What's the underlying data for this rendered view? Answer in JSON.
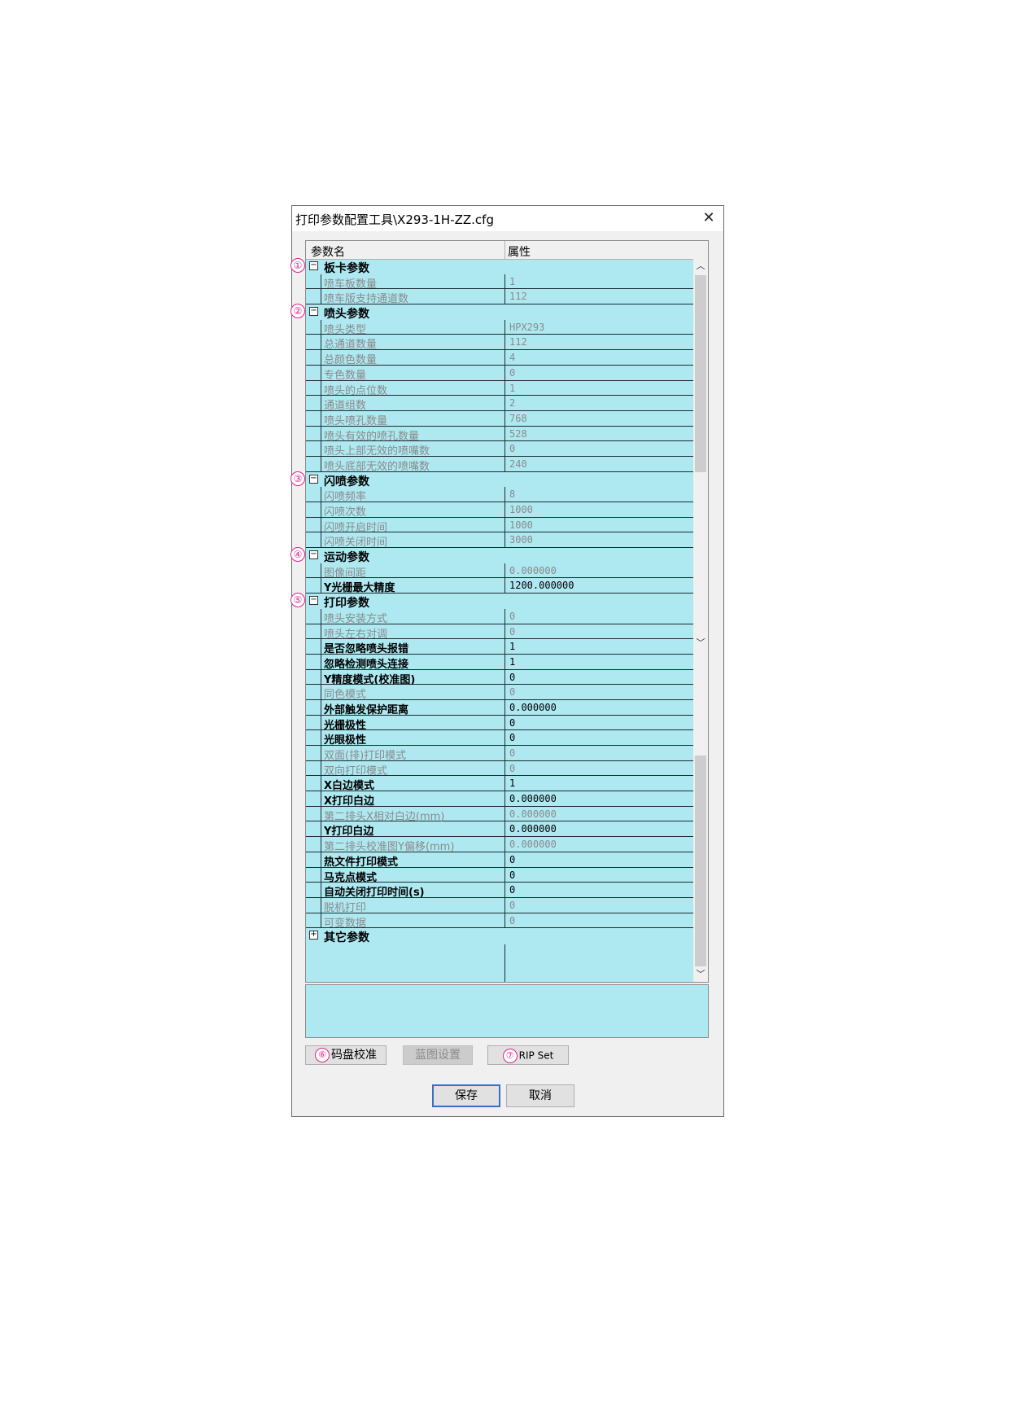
{
  "window": {
    "title": "打印参数配置工具\\X293-1H-ZZ.cfg",
    "close_glyph": "✕"
  },
  "grid": {
    "header_name": "参数名",
    "header_attr": "属性"
  },
  "markers": [
    "①",
    "②",
    "③",
    "④",
    "⑤"
  ],
  "rows": [
    {
      "type": "group",
      "marker": "①",
      "expand": "−",
      "name": "板卡参数"
    },
    {
      "type": "item",
      "enabled": false,
      "name": "喷车板数量",
      "value": "1"
    },
    {
      "type": "item",
      "enabled": false,
      "name": "喷车版支持通道数",
      "value": "112"
    },
    {
      "type": "group",
      "marker": "②",
      "expand": "−",
      "name": "喷头参数"
    },
    {
      "type": "item",
      "enabled": false,
      "name": "喷头类型",
      "value": "HPX293"
    },
    {
      "type": "item",
      "enabled": false,
      "name": "总通道数量",
      "value": "112"
    },
    {
      "type": "item",
      "enabled": false,
      "name": "总颜色数量",
      "value": "4"
    },
    {
      "type": "item",
      "enabled": false,
      "name": "专色数量",
      "value": "0"
    },
    {
      "type": "item",
      "enabled": false,
      "name": "喷头的点位数",
      "value": "1"
    },
    {
      "type": "item",
      "enabled": false,
      "name": "通道组数",
      "value": "2"
    },
    {
      "type": "item",
      "enabled": false,
      "name": "喷头喷孔数量",
      "value": "768"
    },
    {
      "type": "item",
      "enabled": false,
      "name": "喷头有效的喷孔数量",
      "value": "528"
    },
    {
      "type": "item",
      "enabled": false,
      "name": "喷头上部无效的喷嘴数",
      "value": "0"
    },
    {
      "type": "item",
      "enabled": false,
      "name": "喷头底部无效的喷嘴数",
      "value": "240"
    },
    {
      "type": "group",
      "marker": "③",
      "expand": "−",
      "name": "闪喷参数"
    },
    {
      "type": "item",
      "enabled": false,
      "name": "闪喷频率",
      "value": "8"
    },
    {
      "type": "item",
      "enabled": false,
      "name": "闪喷次数",
      "value": "1000"
    },
    {
      "type": "item",
      "enabled": false,
      "name": "闪喷开启时间",
      "value": "1000"
    },
    {
      "type": "item",
      "enabled": false,
      "name": "闪喷关闭时间",
      "value": "3000"
    },
    {
      "type": "group",
      "marker": "④",
      "expand": "−",
      "name": "运动参数"
    },
    {
      "type": "item",
      "enabled": false,
      "name": "图像间距",
      "value": "0.000000"
    },
    {
      "type": "item",
      "enabled": true,
      "name": "Y光栅最大精度",
      "value": "1200.000000"
    },
    {
      "type": "group",
      "marker": "⑤",
      "expand": "−",
      "name": "打印参数"
    },
    {
      "type": "item",
      "enabled": false,
      "name": "喷头安装方式",
      "value": "0"
    },
    {
      "type": "item",
      "enabled": false,
      "name": "喷头左右对调",
      "value": "0"
    },
    {
      "type": "item",
      "enabled": true,
      "name": "是否忽略喷头报错",
      "value": "1"
    },
    {
      "type": "item",
      "enabled": true,
      "name": "忽略检测喷头连接",
      "value": "1"
    },
    {
      "type": "item",
      "enabled": true,
      "name": "Y精度模式(校准图)",
      "value": "0"
    },
    {
      "type": "item",
      "enabled": false,
      "name": "同色模式",
      "value": "0"
    },
    {
      "type": "item",
      "enabled": true,
      "name": "外部触发保护距离",
      "value": "0.000000"
    },
    {
      "type": "item",
      "enabled": true,
      "name": "光栅极性",
      "value": "0"
    },
    {
      "type": "item",
      "enabled": true,
      "name": "光眼极性",
      "value": "0"
    },
    {
      "type": "item",
      "enabled": false,
      "name": "双面(排)打印模式",
      "value": "0"
    },
    {
      "type": "item",
      "enabled": false,
      "name": "双向打印模式",
      "value": "0"
    },
    {
      "type": "item",
      "enabled": true,
      "name": "X白边模式",
      "value": "1"
    },
    {
      "type": "item",
      "enabled": true,
      "name": "X打印白边",
      "value": "0.000000"
    },
    {
      "type": "item",
      "enabled": false,
      "name": "第二排头X相对白边(mm)",
      "value": "0.000000"
    },
    {
      "type": "item",
      "enabled": true,
      "name": "Y打印白边",
      "value": "0.000000"
    },
    {
      "type": "item",
      "enabled": false,
      "name": "第二排头校准图Y偏移(mm)",
      "value": "0.000000"
    },
    {
      "type": "item",
      "enabled": true,
      "name": "热文件打印模式",
      "value": "0"
    },
    {
      "type": "item",
      "enabled": true,
      "name": "马克点模式",
      "value": "0"
    },
    {
      "type": "item",
      "enabled": true,
      "name": "自动关闭打印时间(s)",
      "value": "0"
    },
    {
      "type": "item",
      "enabled": false,
      "name": "脱机打印",
      "value": "0"
    },
    {
      "type": "item",
      "enabled": false,
      "name": "可变数据",
      "value": "0"
    },
    {
      "type": "group",
      "marker": "",
      "expand": "+",
      "name": "其它参数"
    }
  ],
  "scrollbar": {
    "up": "︿",
    "down": "﹀"
  },
  "buttons": {
    "encoder_marker": "⑥",
    "encoder_label": "码盘校准",
    "blueprint_label": "蓝图设置",
    "rip_marker": "⑦",
    "rip_label": "RIP Set",
    "save_label": "保存",
    "cancel_label": "取消"
  }
}
